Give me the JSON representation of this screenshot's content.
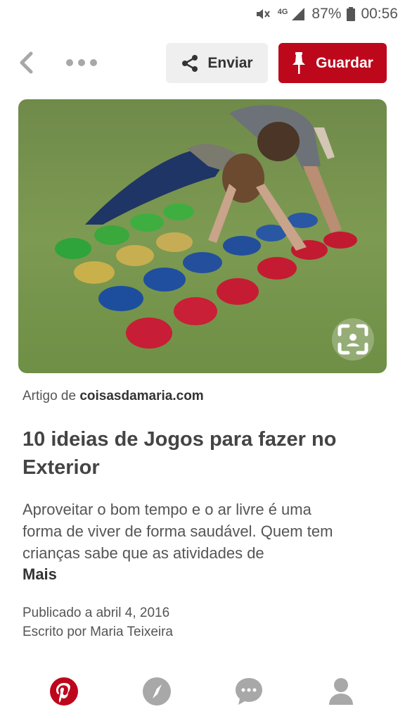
{
  "status_bar": {
    "network": "4G",
    "battery": "87%",
    "time": "00:56"
  },
  "header": {
    "back_icon": "chevron-left-icon",
    "more_icon": "more-horizontal-icon",
    "send_label": "Enviar",
    "save_label": "Guardar"
  },
  "pin": {
    "image_alt": "Twister no jardim",
    "lens_icon": "visual-search-icon"
  },
  "article": {
    "source_prefix": "Artigo de",
    "source_domain": "coisasdamaria.com",
    "title": "10 ideias de Jogos para fazer no Exterior",
    "description": "Aproveitar o bom tempo e o ar livre é uma forma de viver de forma saudável. Quem tem crianças sabe que as atividades de",
    "more_label": "Mais",
    "published": "Publicado a abril 4, 2016",
    "author": "Escrito por Maria Teixeira"
  },
  "bottom_nav": [
    {
      "icon": "pinterest-home-icon",
      "active": true
    },
    {
      "icon": "explore-compass-icon",
      "active": false
    },
    {
      "icon": "messages-icon",
      "active": false
    },
    {
      "icon": "profile-icon",
      "active": false
    }
  ],
  "colors": {
    "brand_red": "#bd081c",
    "inactive_icon": "#a8a8a8"
  }
}
